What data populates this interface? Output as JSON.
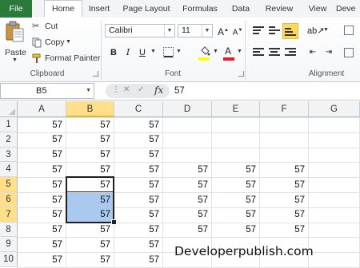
{
  "tabs": [
    "File",
    "Home",
    "Insert",
    "Page Layout",
    "Formulas",
    "Data",
    "Review",
    "View",
    "Deve"
  ],
  "ribbon": {
    "clipboard": {
      "paste_label": "Paste",
      "cut_label": "Cut",
      "copy_label": "Copy",
      "format_painter_label": "Format Painter",
      "group_label": "Clipboard"
    },
    "font": {
      "font_name": "Calibri",
      "font_size": "11",
      "bold_label": "B",
      "italic_label": "I",
      "underline_label": "U",
      "group_label": "Font"
    },
    "alignment": {
      "group_label": "Alignment"
    }
  },
  "formula_bar": {
    "name_box": "B5",
    "fx_label": "fx",
    "value": "57"
  },
  "grid": {
    "columns": [
      "A",
      "B",
      "C",
      "D",
      "E",
      "F",
      "G"
    ],
    "rows": [
      "1",
      "2",
      "3",
      "4",
      "5",
      "6",
      "7",
      "8",
      "9",
      "10"
    ],
    "cells": [
      [
        "57",
        "57",
        "57",
        "",
        "",
        "",
        ""
      ],
      [
        "57",
        "57",
        "57",
        "",
        "",
        "",
        ""
      ],
      [
        "57",
        "57",
        "57",
        "",
        "",
        "",
        ""
      ],
      [
        "57",
        "57",
        "57",
        "57",
        "57",
        "57",
        ""
      ],
      [
        "57",
        "57",
        "57",
        "57",
        "57",
        "57",
        ""
      ],
      [
        "57",
        "57",
        "57",
        "57",
        "57",
        "57",
        ""
      ],
      [
        "57",
        "57",
        "57",
        "57",
        "57",
        "57",
        ""
      ],
      [
        "57",
        "57",
        "57",
        "57",
        "57",
        "57",
        ""
      ],
      [
        "57",
        "57",
        "57",
        "",
        "",
        "",
        ""
      ],
      [
        "57",
        "57",
        "57",
        "",
        "",
        "",
        ""
      ]
    ],
    "active_cell": "B5",
    "selection": "B5:B7"
  },
  "watermark": "Developerpublish.com",
  "colors": {
    "file_tab": "#2a7a3b",
    "selection_fill": "#a9c9ee",
    "header_highlight": "#ffdf8a",
    "highlight_button": "#fcd95c"
  }
}
